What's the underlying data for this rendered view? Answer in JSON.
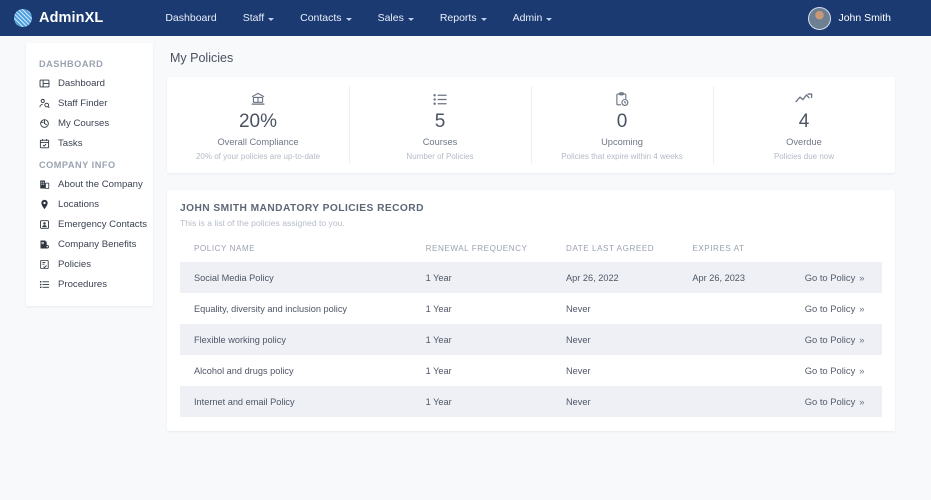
{
  "header": {
    "brand": "AdminXL",
    "brand_icon": "circle-hatch-logo",
    "nav": [
      {
        "label": "Dashboard",
        "caret": false
      },
      {
        "label": "Staff",
        "caret": true
      },
      {
        "label": "Contacts",
        "caret": true
      },
      {
        "label": "Sales",
        "caret": true
      },
      {
        "label": "Reports",
        "caret": true
      },
      {
        "label": "Admin",
        "caret": true
      }
    ],
    "user": {
      "name": "John Smith",
      "avatar_icon": "user-avatar"
    },
    "bg_color": "#1b3a72"
  },
  "sidebar": {
    "groups": [
      {
        "title": "DASHBOARD",
        "items": [
          {
            "label": "Dashboard",
            "icon": "grid-dashboard-icon"
          },
          {
            "label": "Staff Finder",
            "icon": "person-search-icon"
          },
          {
            "label": "My Courses",
            "icon": "courses-badge-icon"
          },
          {
            "label": "Tasks",
            "icon": "calendar-check-icon"
          }
        ]
      },
      {
        "title": "COMPANY INFO",
        "items": [
          {
            "label": "About the Company",
            "icon": "building-info-icon"
          },
          {
            "label": "Locations",
            "icon": "map-pin-icon"
          },
          {
            "label": "Emergency Contacts",
            "icon": "emergency-contact-icon"
          },
          {
            "label": "Company Benefits",
            "icon": "benefits-doc-icon"
          },
          {
            "label": "Policies",
            "icon": "policy-doc-icon"
          },
          {
            "label": "Procedures",
            "icon": "list-lines-icon"
          }
        ]
      }
    ]
  },
  "main": {
    "page_title": "My Policies",
    "stats": [
      {
        "icon": "bank-briefcase-icon",
        "value": "20%",
        "label": "Overall Compliance",
        "sub": "20% of your policies are up-to-date"
      },
      {
        "icon": "list-icon",
        "value": "5",
        "label": "Courses",
        "sub": "Number of Policies"
      },
      {
        "icon": "clipboard-clock-icon",
        "value": "0",
        "label": "Upcoming",
        "sub": "Policies that expire within 4 weeks"
      },
      {
        "icon": "trend-line-icon",
        "value": "4",
        "label": "Overdue",
        "sub": "Policies due now"
      }
    ],
    "panel": {
      "title": "JOHN SMITH MANDATORY POLICIES RECORD",
      "subtitle": "This is a list of the policies assigned to you.",
      "columns": [
        "POLICY NAME",
        "RENEWAL FREQUENCY",
        "DATE LAST AGREED",
        "EXPIRES AT",
        ""
      ],
      "rows": [
        {
          "name": "Social Media Policy",
          "frequency": "1 Year",
          "last_agreed": "Apr 26, 2022",
          "expires_at": "Apr 26, 2023",
          "action": "Go to Policy",
          "chevron": "»"
        },
        {
          "name": "Equality, diversity and inclusion policy",
          "frequency": "1 Year",
          "last_agreed": "Never",
          "expires_at": "",
          "action": "Go to Policy",
          "chevron": "»"
        },
        {
          "name": "Flexible working policy",
          "frequency": "1 Year",
          "last_agreed": "Never",
          "expires_at": "",
          "action": "Go to Policy",
          "chevron": "»"
        },
        {
          "name": "Alcohol and drugs policy",
          "frequency": "1 Year",
          "last_agreed": "Never",
          "expires_at": "",
          "action": "Go to Policy",
          "chevron": "»"
        },
        {
          "name": "Internet and email Policy",
          "frequency": "1 Year",
          "last_agreed": "Never",
          "expires_at": "",
          "action": "Go to Policy",
          "chevron": "»"
        }
      ]
    }
  },
  "colors": {
    "page_bg": "#f7f9fb",
    "nav_bg": "#1b3a72",
    "card_bg": "#ffffff",
    "row_alt_bg": "#eef0f6",
    "accent": "#4c9fe0"
  }
}
